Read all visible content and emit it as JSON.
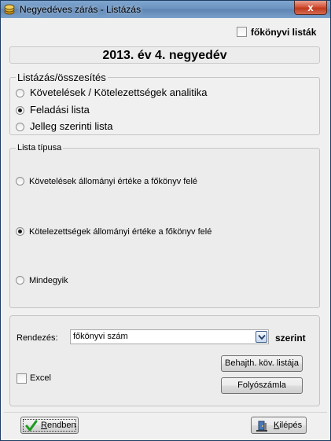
{
  "window": {
    "title": "Negyedéves zárás - Listázás",
    "close_label": "x"
  },
  "fokonyvi_listak": {
    "label": "főkönyvi listák",
    "checked": false
  },
  "period": {
    "text": "2013. év 4. negyedév"
  },
  "listazas": {
    "legend": "Listázás/összesítés",
    "options": [
      {
        "label": "Követelések / Kötelezettségek analitika",
        "selected": false
      },
      {
        "label": "Feladási lista",
        "selected": true
      },
      {
        "label": "Jelleg szerinti lista",
        "selected": false
      }
    ]
  },
  "lista_tipusa": {
    "legend": "Lista típusa",
    "options": [
      {
        "label": "Követelések állományi értéke a főkönyv felé",
        "selected": false
      },
      {
        "label": "Kötelezettségek állományi értéke a főkönyv felé",
        "selected": true
      },
      {
        "label": "Mindegyik",
        "selected": false
      }
    ]
  },
  "rendezes": {
    "label": "Rendezés:",
    "value": "főkönyvi szám",
    "suffix": "szerint"
  },
  "excel": {
    "label": "Excel",
    "checked": false
  },
  "buttons": {
    "behajth": "Behajth. köv. listája",
    "folyoszamla": "Folyószámla",
    "rendben_underlined": "R",
    "rendben_rest": "endben",
    "kilepes_underlined": "K",
    "kilepes_rest": "ilépés"
  },
  "icons": {
    "app": "coins-icon",
    "ok": "checkmark-icon",
    "exit": "exit-door-icon"
  },
  "colors": {
    "title_bar": "#6c93c0",
    "close_button": "#c8452a",
    "checkmark": "#1f9a1f"
  }
}
